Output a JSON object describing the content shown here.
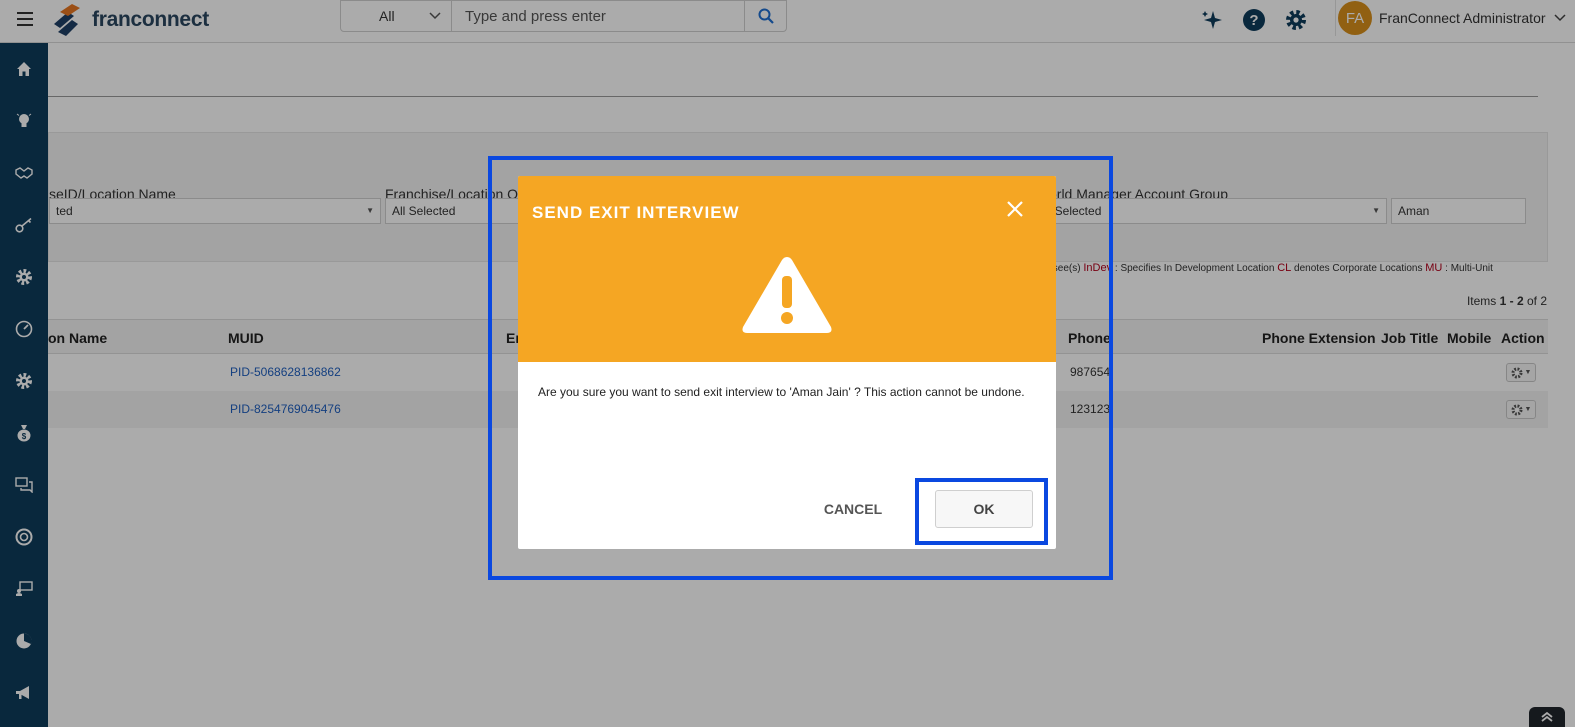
{
  "header": {
    "logo_text": "franconnect",
    "search": {
      "scope": "All",
      "placeholder": "Type and press enter"
    },
    "user": {
      "initials": "FA",
      "name": "FranConnect Administrator"
    },
    "icons": [
      "menu-icon",
      "sparkle-icon",
      "help-icon",
      "settings-icon",
      "search-icon",
      "chevron-down-icon"
    ]
  },
  "sidebar": {
    "icons": [
      "home-icon",
      "lightbulb-icon",
      "handshake-icon",
      "key-icon",
      "gear-icon",
      "dashboard-icon",
      "gear-icon",
      "money-bag-icon",
      "chat-icon",
      "lifebuoy-icon",
      "training-icon",
      "pie-chart-icon",
      "megaphone-icon"
    ]
  },
  "filters": {
    "field1": {
      "label": "seID/Location Name",
      "value": "ted"
    },
    "field2": {
      "label": "Franchise/Location O",
      "value": "All Selected"
    },
    "field3": {
      "label": "orld Manager Account Group",
      "value": "ll Selected"
    },
    "search_value": "Aman"
  },
  "legend": {
    "part1": "chisee(s)",
    "indev_code": "InDev",
    "indev_text": " : Specifies In Development Location",
    "cl_code": "CL",
    "cl_text": " denotes Corporate Locations",
    "mu_code": "MU",
    "mu_text": " : Multi-Unit"
  },
  "items": {
    "prefix": "Items ",
    "range": "1 - 2",
    "suffix": " of 2"
  },
  "table": {
    "headers": {
      "location_name": "on Name",
      "muid": "MUID",
      "email": "Em",
      "phone": "Phone",
      "phone_ext": "Phone Extension",
      "job_title": "Job Title",
      "mobile": "Mobile",
      "action": "Action"
    },
    "rows": [
      {
        "muid": "PID-5068628136862",
        "phone": "987654"
      },
      {
        "muid": "PID-8254769045476",
        "phone": "123123"
      }
    ]
  },
  "modal": {
    "title": "SEND EXIT INTERVIEW",
    "message": "Are you sure you want to send exit interview to 'Aman Jain' ? This action cannot be undone.",
    "cancel_label": "CANCEL",
    "ok_label": "OK"
  },
  "colors": {
    "sidebar": "#0e3c5c",
    "modal_header": "#f5a623",
    "highlight": "#0a48e0",
    "link": "#1f5fbf",
    "avatar": "#d9901c"
  }
}
